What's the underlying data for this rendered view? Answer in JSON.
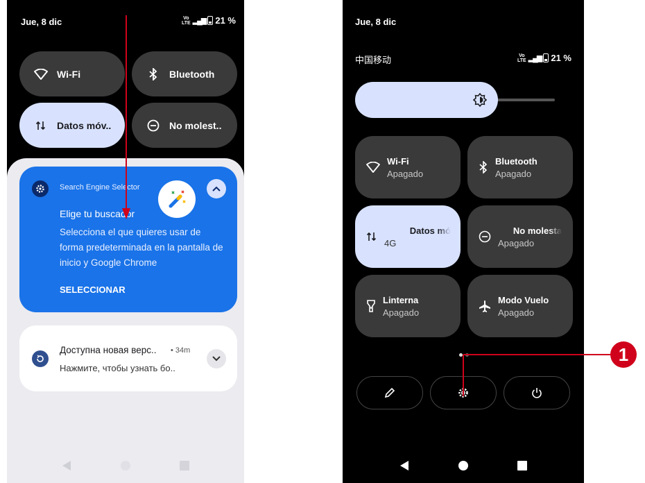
{
  "left": {
    "status": {
      "date": "Jue, 8 dic",
      "net_top": "Vo",
      "net_bottom": "LTE",
      "net_gen": "4G",
      "battery": "21 %"
    },
    "tiles": [
      {
        "icon": "wifi-icon",
        "label": "Wi-Fi"
      },
      {
        "icon": "bluetooth-icon",
        "label": "Bluetooth"
      },
      {
        "icon": "mobile-data-icon",
        "label": "Datos móv.."
      },
      {
        "icon": "do-not-disturb-icon",
        "label": "No molest.."
      }
    ],
    "notification1": {
      "app": "Search Engine Selector",
      "title": "Elige tu buscador",
      "body": "Selecciona el que quieres usar de forma predeterminada en la pantalla de inicio y Google Chrome",
      "action": "SELECCIONAR"
    },
    "notification2": {
      "title": "Доступна новая верс..",
      "time": "• 34m",
      "body": "Нажмите, чтобы узнать бо.."
    }
  },
  "right": {
    "status": {
      "date": "Jue, 8 dic",
      "carrier": "中国移动",
      "battery": "21 %"
    },
    "tiles": [
      {
        "label": "Wi-Fi",
        "state": "Apagado"
      },
      {
        "label": "Bluetooth",
        "state": "Apagado"
      },
      {
        "label": "Datos mó",
        "state": "4G"
      },
      {
        "label": "No molesta",
        "state": "Apagado"
      },
      {
        "label": "Linterna",
        "state": "Apagado"
      },
      {
        "label": "Modo Vuelo",
        "state": "Apagado"
      }
    ]
  },
  "callout": "1",
  "colors": {
    "accent_blue": "#1a73e8",
    "tile_light": "#d8e2ff",
    "callout_red": "#d0021b"
  }
}
